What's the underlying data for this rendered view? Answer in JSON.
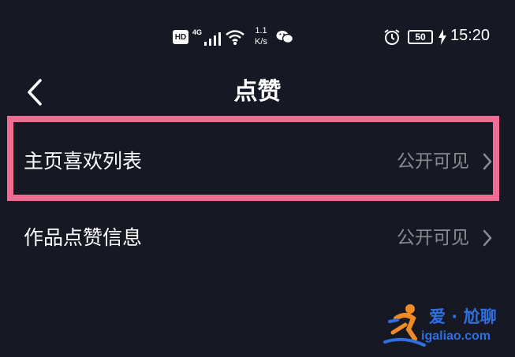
{
  "status_bar": {
    "hd_badge": "HD",
    "network_type": "4G",
    "speed_value": "1.1",
    "speed_unit": "K/s",
    "battery_level": "50",
    "time": "15:20"
  },
  "header": {
    "back_icon": "chevron-left-icon",
    "title": "点赞"
  },
  "settings": [
    {
      "label": "主页喜欢列表",
      "value": "公开可见",
      "highlighted": true
    },
    {
      "label": "作品点赞信息",
      "value": "公开可见",
      "highlighted": false
    }
  ],
  "watermark": {
    "text": "爱 · 尬聊",
    "url": "igaliao.com"
  },
  "colors": {
    "background": "#161823",
    "highlight_border": "#f06c93",
    "secondary_text": "#8a8b91",
    "watermark_blue": "#2f6fe0",
    "watermark_orange": "#f08a24"
  }
}
